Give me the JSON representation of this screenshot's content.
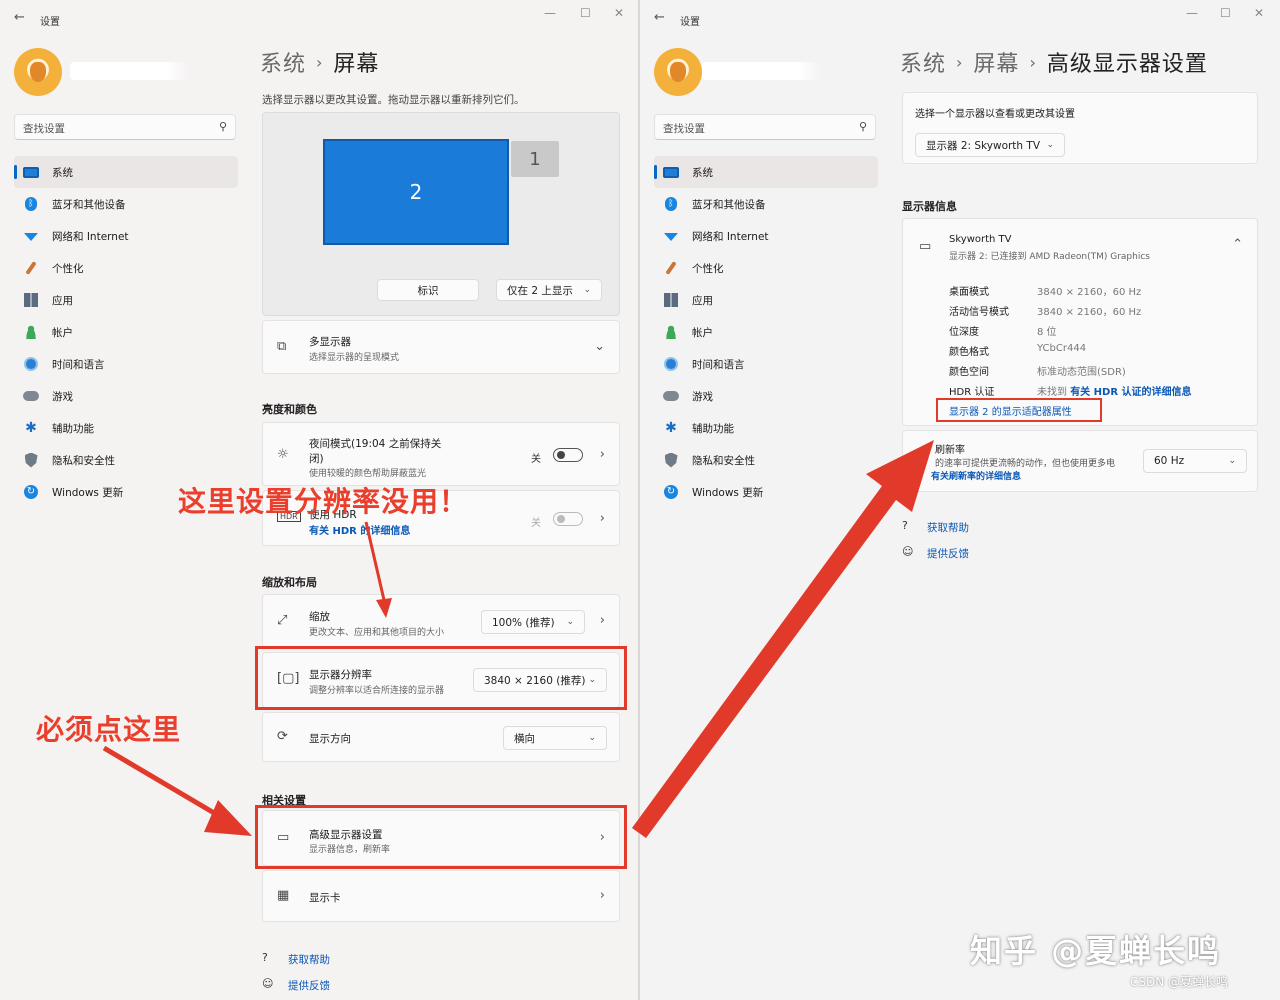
{
  "left": {
    "window_title": "设置",
    "search_placeholder": "查找设置",
    "nav": [
      {
        "label": "系统",
        "icon": "monitor-icon"
      },
      {
        "label": "蓝牙和其他设备",
        "icon": "bluetooth-icon"
      },
      {
        "label": "网络和 Internet",
        "icon": "wifi-icon"
      },
      {
        "label": "个性化",
        "icon": "brush-icon"
      },
      {
        "label": "应用",
        "icon": "apps-icon"
      },
      {
        "label": "帐户",
        "icon": "user-icon"
      },
      {
        "label": "时间和语言",
        "icon": "globe-clock-icon"
      },
      {
        "label": "游戏",
        "icon": "gamepad-icon"
      },
      {
        "label": "辅助功能",
        "icon": "accessibility-icon"
      },
      {
        "label": "隐私和安全性",
        "icon": "shield-icon"
      },
      {
        "label": "Windows 更新",
        "icon": "update-icon"
      }
    ],
    "breadcrumb": [
      "系统",
      "屏幕"
    ],
    "hint": "选择显示器以更改其设置。拖动显示器以重新排列它们。",
    "monitor_main": "2",
    "monitor_secondary": "1",
    "identify_button": "标识",
    "display_mode": "仅在 2 上显示",
    "multi_display": {
      "title": "多显示器",
      "sub": "选择显示器的呈现模式"
    },
    "section_brightness": "亮度和颜色",
    "night_light": {
      "title": "夜间模式(19:04 之前保持关闭)",
      "title_line1": "夜间模式(19:04 之前保持关",
      "title_line2": "闭)",
      "sub": "使用较暖的颜色帮助屏蔽蓝光",
      "state": "关"
    },
    "hdr": {
      "title": "使用 HDR",
      "link": "有关 HDR 的详细信息",
      "state": "关"
    },
    "section_scale": "缩放和布局",
    "scale": {
      "title": "缩放",
      "sub": "更改文本、应用和其他项目的大小",
      "value": "100% (推荐)"
    },
    "resolution": {
      "title": "显示器分辨率",
      "sub": "调整分辨率以适合所连接的显示器",
      "value": "3840 × 2160 (推荐)"
    },
    "orientation": {
      "title": "显示方向",
      "value": "横向"
    },
    "section_related": "相关设置",
    "advanced": {
      "title": "高级显示器设置",
      "sub": "显示器信息，刷新率"
    },
    "graphics": {
      "title": "显示卡"
    },
    "get_help": "获取帮助",
    "feedback": "提供反馈"
  },
  "right": {
    "window_title": "设置",
    "search_placeholder": "查找设置",
    "breadcrumb": [
      "系统",
      "屏幕",
      "高级显示器设置"
    ],
    "select_label": "选择一个显示器以查看或更改其设置",
    "select_value": "显示器 2: Skyworth TV",
    "section_info": "显示器信息",
    "device_name": "Skyworth TV",
    "device_sub": "显示器 2: 已连接到 AMD Radeon(TM) Graphics",
    "info": [
      {
        "k": "桌面模式",
        "v": "3840 × 2160，60 Hz"
      },
      {
        "k": "活动信号模式",
        "v": "3840 × 2160，60 Hz"
      },
      {
        "k": "位深度",
        "v": "8 位"
      },
      {
        "k": "颜色格式",
        "v": "YCbCr444"
      },
      {
        "k": "颜色空间",
        "v": "标准动态范围(SDR)"
      }
    ],
    "hdr_cert": {
      "k": "HDR 认证",
      "v_prefix": "未找到",
      "v_link": "有关 HDR 认证的详细信息"
    },
    "adapter_link": "显示器 2 的显示适配器属性",
    "refresh": {
      "title": "刷新率",
      "sub": "的速率可提供更流畅的动作，但也使用更多电",
      "link": "有关刷新率的详细信息",
      "value": "60 Hz"
    },
    "get_help": "获取帮助",
    "feedback": "提供反馈"
  },
  "annotations": {
    "no_use": "这里设置分辨率没用！",
    "must_click": "必须点这里",
    "color": "#ea3f2c"
  },
  "watermark": "知乎 @夏蝉长鸣",
  "csdn": "CSDN @夏蝉长鸣",
  "colors": {
    "accent": "#1a7bd9",
    "link": "#0a58b5",
    "annotation": "#e23a2a"
  }
}
